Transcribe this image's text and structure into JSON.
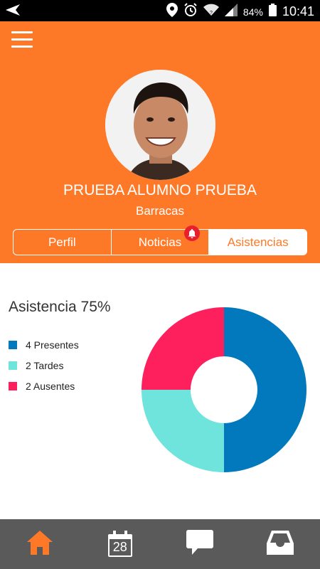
{
  "status_bar": {
    "battery": "84%",
    "time": "10:41"
  },
  "profile": {
    "name": "PRUEBA ALUMNO PRUEBA",
    "location": "Barracas"
  },
  "tabs": [
    {
      "label": "Perfil",
      "active": false
    },
    {
      "label": "Noticias",
      "active": false,
      "has_notification": true
    },
    {
      "label": "Asistencias",
      "active": true
    }
  ],
  "attendance": {
    "title": "Asistencia 75%"
  },
  "colors": {
    "brand": "#fd7928",
    "presentes": "#0279bd",
    "tardes": "#6fe4dc",
    "ausentes": "#fe1f5d",
    "nav_bg": "#5a5a5a",
    "nav_active": "#fd7928"
  },
  "chart_data": {
    "type": "pie",
    "donut": true,
    "title": "Asistencia 75%",
    "slices": [
      {
        "label": "4 Presentes",
        "value": 4,
        "color": "#0279bd"
      },
      {
        "label": "2 Tardes",
        "value": 2,
        "color": "#6fe4dc"
      },
      {
        "label": "2 Ausentes",
        "value": 2,
        "color": "#fe1f5d"
      }
    ],
    "legend_position": "left"
  },
  "bottom_nav": {
    "calendar_day": "28",
    "items": [
      "home-icon",
      "calendar-icon",
      "chat-icon",
      "inbox-icon"
    ]
  }
}
